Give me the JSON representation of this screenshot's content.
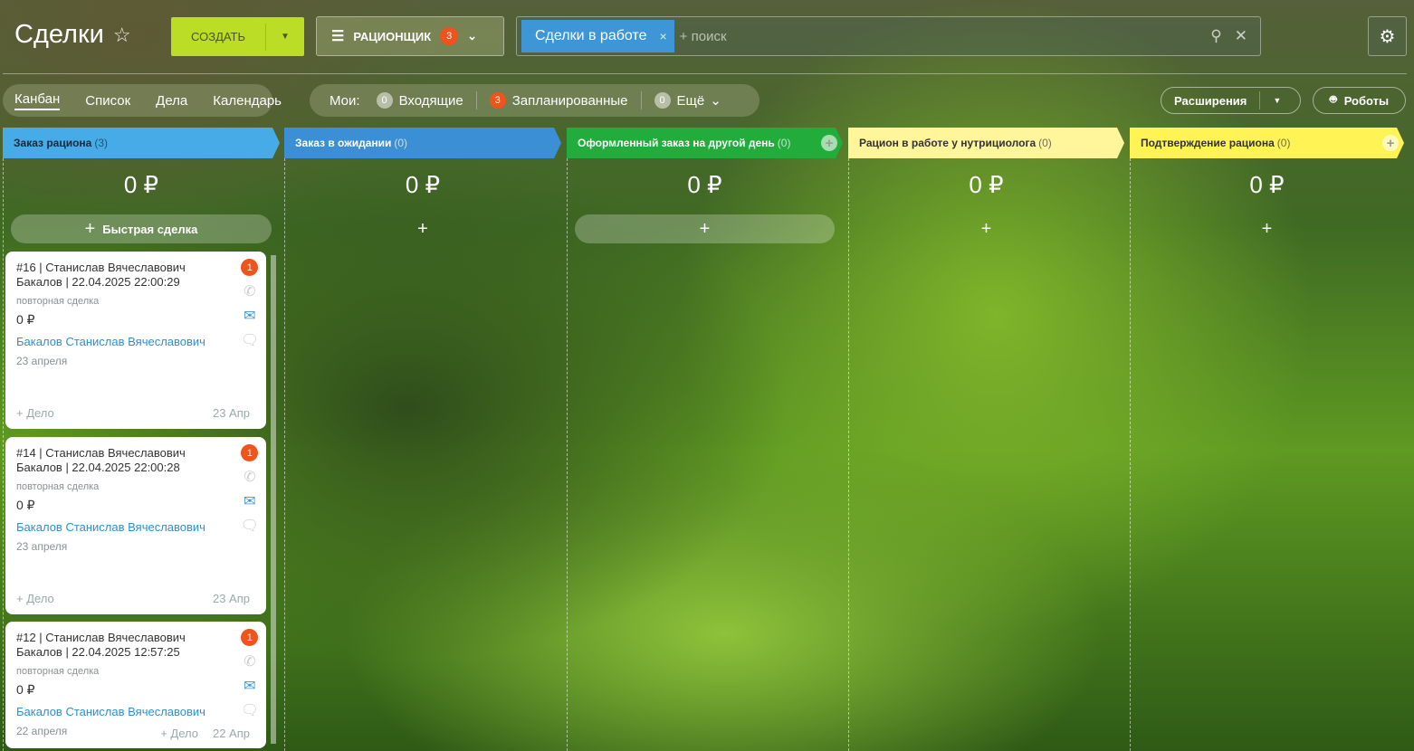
{
  "header": {
    "title": "Сделки",
    "create_label": "СОЗДАТЬ",
    "filter_label": "РАЦИОНЩИК",
    "filter_count": "3",
    "search_chip": "Сделки в работе",
    "search_placeholder": "+ поиск"
  },
  "views": [
    {
      "label": "Канбан",
      "active": true
    },
    {
      "label": "Список"
    },
    {
      "label": "Дела"
    },
    {
      "label": "Календарь"
    }
  ],
  "mine": {
    "label": "Мои:",
    "items": [
      {
        "count": "0",
        "label": "Входящие"
      },
      {
        "count": "3",
        "label": "Запланированные"
      },
      {
        "count": "0",
        "label": "Ещё"
      }
    ]
  },
  "toolbar": {
    "extensions": "Расширения",
    "robots": "Роботы"
  },
  "columns": [
    {
      "title": "Заказ рациона",
      "count": "(3)",
      "sum": "0 ₽",
      "color": "#47abe8",
      "text": "#1a2a3a",
      "quick": "Быстрая сделка"
    },
    {
      "title": "Заказ в ожидании",
      "count": "(0)",
      "sum": "0 ₽",
      "color": "#3b8fd4",
      "text": "#fff"
    },
    {
      "title": "Оформленный заказ на другой день",
      "count": "(0)",
      "sum": "0 ₽",
      "color": "#22ac3c",
      "text": "#fff"
    },
    {
      "title": "Рацион в работе у нутрициолога",
      "count": "(0)",
      "sum": "0 ₽",
      "color": "#fff59a",
      "text": "#333"
    },
    {
      "title": "Подтверждение рациона",
      "count": "(0)",
      "sum": "0 ₽",
      "color": "#fff356",
      "text": "#333"
    }
  ],
  "cards": [
    {
      "title": "#16 | Станислав Вячеславович Бакалов | 22.04.2025 22:00:29",
      "subtitle": "повторная сделка",
      "amount": "0 ₽",
      "client": "Бакалов Станислав Вячеславович",
      "date": "23 апреля",
      "badge": "1",
      "add_task": "+ Дело",
      "short_date": "23 Апр"
    },
    {
      "title": "#14 | Станислав Вячеславович Бакалов | 22.04.2025 22:00:28",
      "subtitle": "повторная сделка",
      "amount": "0 ₽",
      "client": "Бакалов Станислав Вячеславович",
      "date": "23 апреля",
      "badge": "1",
      "add_task": "+ Дело",
      "short_date": "23 Апр"
    },
    {
      "title": "#12 | Станислав Вячеславович Бакалов | 22.04.2025 12:57:25",
      "subtitle": "повторная сделка",
      "amount": "0 ₽",
      "client": "Бакалов Станислав Вячеславович",
      "date": "22 апреля",
      "badge": "1",
      "add_task": "+ Дело",
      "short_date": "22 Апр"
    }
  ]
}
